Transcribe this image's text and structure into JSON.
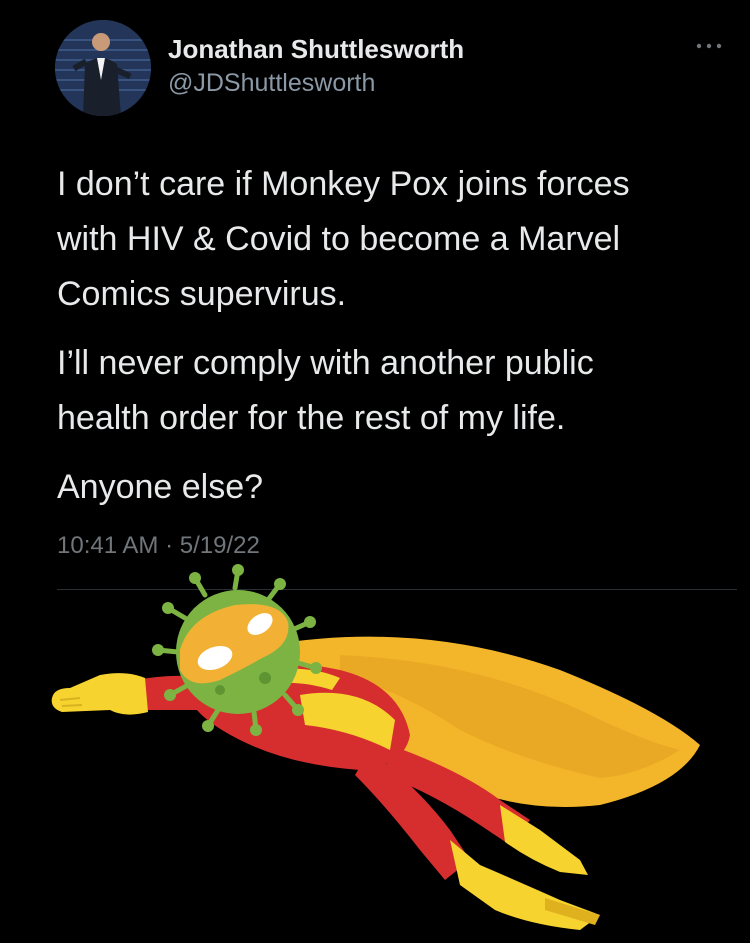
{
  "tweet": {
    "author": {
      "display_name": "Jonathan Shuttlesworth",
      "handle": "@JDShuttlesworth",
      "avatar_icon": "profile-photo"
    },
    "more_icon": "more-horizontal-icon",
    "paragraphs": [
      "I don’t care if Monkey Pox joins forces\nwith HIV & Covid to become a Marvel\nComics supervirus.",
      "I’ll never comply with another public\nhealth order for the rest of my life.",
      "Anyone else?"
    ],
    "timestamp": "10:41 AM · 5/19/22"
  },
  "illustration": {
    "subject": "virus-superhero",
    "colors": {
      "virus": "#7cb342",
      "mask": "#f2b134",
      "suit": "#d62e2e",
      "cape": "#f3b62b",
      "gloves": "#f6d32e"
    }
  },
  "colors": {
    "background": "#000000",
    "text_primary": "#e7e9ea",
    "text_secondary": "#8b98a5"
  }
}
